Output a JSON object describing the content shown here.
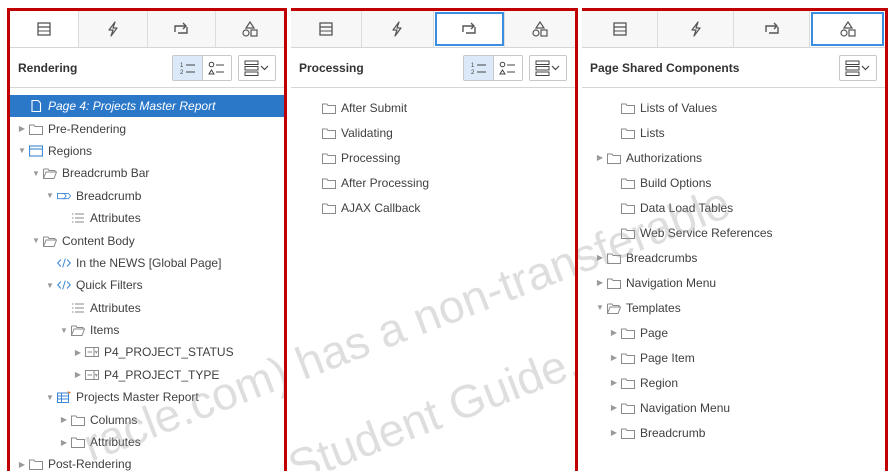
{
  "left": {
    "title": "Rendering",
    "tree": [
      {
        "label": "Page 4: Projects Master Report",
        "icon": "page-icon",
        "twisty": "",
        "depth": 0,
        "selected": true
      },
      {
        "label": "Pre-Rendering",
        "icon": "folder-icon",
        "twisty": "▶",
        "depth": 0
      },
      {
        "label": "Regions",
        "icon": "region-icon",
        "twisty": "▼",
        "depth": 0
      },
      {
        "label": "Breadcrumb Bar",
        "icon": "folder-open-icon",
        "twisty": "▼",
        "depth": 1
      },
      {
        "label": "Breadcrumb",
        "icon": "breadcrumb-icon",
        "twisty": "▼",
        "depth": 2
      },
      {
        "label": "Attributes",
        "icon": "attributes-icon",
        "twisty": "",
        "depth": 3
      },
      {
        "label": "Content Body",
        "icon": "folder-open-icon",
        "twisty": "▼",
        "depth": 1
      },
      {
        "label": "In the NEWS [Global Page]",
        "icon": "code-icon",
        "twisty": "",
        "depth": 2
      },
      {
        "label": "Quick Filters",
        "icon": "code-icon",
        "twisty": "▼",
        "depth": 2
      },
      {
        "label": "Attributes",
        "icon": "attributes-icon",
        "twisty": "",
        "depth": 3
      },
      {
        "label": "Items",
        "icon": "folder-open-icon",
        "twisty": "▼",
        "depth": 3
      },
      {
        "label": "P4_PROJECT_STATUS",
        "icon": "select-list-icon",
        "twisty": "▶",
        "depth": 4
      },
      {
        "label": "P4_PROJECT_TYPE",
        "icon": "select-list-icon",
        "twisty": "▶",
        "depth": 4
      },
      {
        "label": "Projects Master Report",
        "icon": "report-icon",
        "twisty": "▼",
        "depth": 2
      },
      {
        "label": "Columns",
        "icon": "folder-icon",
        "twisty": "▶",
        "depth": 3
      },
      {
        "label": "Attributes",
        "icon": "folder-icon",
        "twisty": "▶",
        "depth": 3
      },
      {
        "label": "Post-Rendering",
        "icon": "folder-icon",
        "twisty": "▶",
        "depth": 0
      }
    ]
  },
  "mid": {
    "title": "Processing",
    "tree": [
      {
        "label": "After Submit",
        "icon": "folder-icon",
        "twisty": "",
        "depth": 1
      },
      {
        "label": "Validating",
        "icon": "folder-icon",
        "twisty": "",
        "depth": 1
      },
      {
        "label": "Processing",
        "icon": "folder-icon",
        "twisty": "",
        "depth": 1
      },
      {
        "label": "After Processing",
        "icon": "folder-icon",
        "twisty": "",
        "depth": 1
      },
      {
        "label": "AJAX Callback",
        "icon": "folder-icon",
        "twisty": "",
        "depth": 1
      }
    ]
  },
  "right": {
    "title": "Page Shared Components",
    "tree": [
      {
        "label": "Lists of Values",
        "icon": "folder-icon",
        "twisty": "",
        "depth": 1
      },
      {
        "label": "Lists",
        "icon": "folder-icon",
        "twisty": "",
        "depth": 1
      },
      {
        "label": "Authorizations",
        "icon": "folder-icon",
        "twisty": "▶",
        "depth": 0
      },
      {
        "label": "Build Options",
        "icon": "folder-icon",
        "twisty": "",
        "depth": 1
      },
      {
        "label": "Data Load Tables",
        "icon": "folder-icon",
        "twisty": "",
        "depth": 1
      },
      {
        "label": "Web Service References",
        "icon": "folder-icon",
        "twisty": "",
        "depth": 1
      },
      {
        "label": "Breadcrumbs",
        "icon": "folder-icon",
        "twisty": "▶",
        "depth": 0
      },
      {
        "label": "Navigation Menu",
        "icon": "folder-icon",
        "twisty": "▶",
        "depth": 0
      },
      {
        "label": "Templates",
        "icon": "folder-open-icon",
        "twisty": "▼",
        "depth": 0
      },
      {
        "label": "Page",
        "icon": "folder-icon",
        "twisty": "▶",
        "depth": 1
      },
      {
        "label": "Page Item",
        "icon": "folder-icon",
        "twisty": "▶",
        "depth": 1
      },
      {
        "label": "Region",
        "icon": "folder-icon",
        "twisty": "▶",
        "depth": 1
      },
      {
        "label": "Navigation Menu",
        "icon": "folder-icon",
        "twisty": "▶",
        "depth": 1
      },
      {
        "label": "Breadcrumb",
        "icon": "folder-icon",
        "twisty": "▶",
        "depth": 1
      }
    ]
  },
  "tabs": [
    {
      "name": "rendering-tab",
      "icon": "rendering-icon"
    },
    {
      "name": "dynamic-actions-tab",
      "icon": "lightning-icon"
    },
    {
      "name": "processing-tab",
      "icon": "processing-icon"
    },
    {
      "name": "shared-components-tab",
      "icon": "shared-components-icon"
    }
  ],
  "watermark": {
    "line1": "racle.com) has a non-transferable",
    "line2": "Student Guide."
  },
  "colors": {
    "frame": "#c00000",
    "selection": "#2b78c8",
    "active_tab_outline": "#3a8de0",
    "toggle_on": "#dbe9f8"
  }
}
